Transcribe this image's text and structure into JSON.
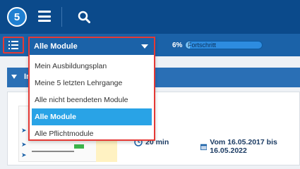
{
  "app": {
    "logo_text": "5",
    "icons": {
      "menu": "hamburger-menu-icon",
      "search": "search-icon",
      "list": "list-icon"
    }
  },
  "toolbar": {
    "module_filter": {
      "selected": "Alle Module",
      "options": [
        "Mein Ausbildungsplan",
        "Meine 5 letzten Lehrgange",
        "Alle nicht beendeten Module",
        "Alle Module",
        "Alle Pflichtmodule"
      ]
    },
    "progress": {
      "percent_text": "6%",
      "label": "Fortschritt",
      "value": 0.06
    }
  },
  "section": {
    "title_visible": "In"
  },
  "card": {
    "title_visible": "t",
    "duration": "20 min",
    "date_range": "Vom 16.05.2017 bis 16.05.2022"
  },
  "colors": {
    "topbar": "#0b4a8b",
    "toolbar": "#1b62a8",
    "highlight_border": "#e53935",
    "selected_option": "#29a3e6"
  }
}
